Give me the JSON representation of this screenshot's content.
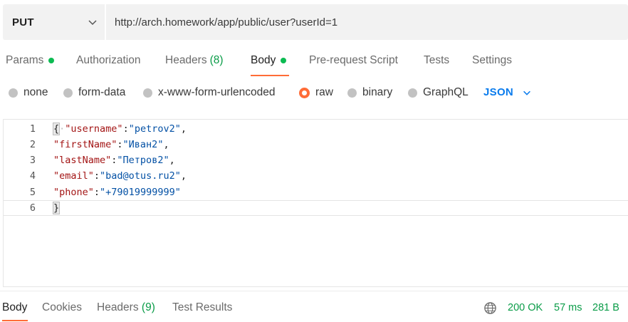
{
  "request": {
    "method": "PUT",
    "url": "http://arch.homework/app/public/user?userId=1"
  },
  "tabs": [
    {
      "label": "Params",
      "has_dot": true
    },
    {
      "label": "Authorization"
    },
    {
      "label": "Headers",
      "count": "(8)"
    },
    {
      "label": "Body",
      "has_dot": true,
      "active": true
    },
    {
      "label": "Pre-request Script"
    },
    {
      "label": "Tests"
    },
    {
      "label": "Settings"
    }
  ],
  "body_types": [
    {
      "label": "none"
    },
    {
      "label": "form-data"
    },
    {
      "label": "x-www-form-urlencoded"
    },
    {
      "label": "raw",
      "selected": true
    },
    {
      "label": "binary"
    },
    {
      "label": "GraphQL"
    }
  ],
  "format": "JSON",
  "editor": {
    "lines": [
      {
        "n": "1",
        "key": "\"username\"",
        "value": "\"petrov2\"",
        "punct": ","
      },
      {
        "n": "2",
        "key": "\"firstName\"",
        "value": "\"Иван2\"",
        "punct": ","
      },
      {
        "n": "3",
        "key": "\"lastName\"",
        "value": "\"Петров2\"",
        "punct": ","
      },
      {
        "n": "4",
        "key": "\"email\"",
        "value": "\"bad@otus.ru2\"",
        "punct": ","
      },
      {
        "n": "5",
        "key": "\"phone\"",
        "value": "\"+79019999999\"",
        "punct": ""
      },
      {
        "n": "6",
        "close": "}"
      }
    ],
    "open_brace": "{",
    "fold_marker": "·"
  },
  "response": {
    "tabs": [
      {
        "label": "Body",
        "active": true
      },
      {
        "label": "Cookies"
      },
      {
        "label": "Headers",
        "count": "(9)"
      },
      {
        "label": "Test Results"
      }
    ],
    "status": "200 OK",
    "time": "57 ms",
    "size": "281 B"
  },
  "colors": {
    "accent": "#ff6c37",
    "success": "#0cbb52",
    "link": "#097bed"
  },
  "icons": {
    "method_dropdown": "chevron-down-icon",
    "format_dropdown": "chevron-down-icon",
    "network": "globe-icon"
  }
}
